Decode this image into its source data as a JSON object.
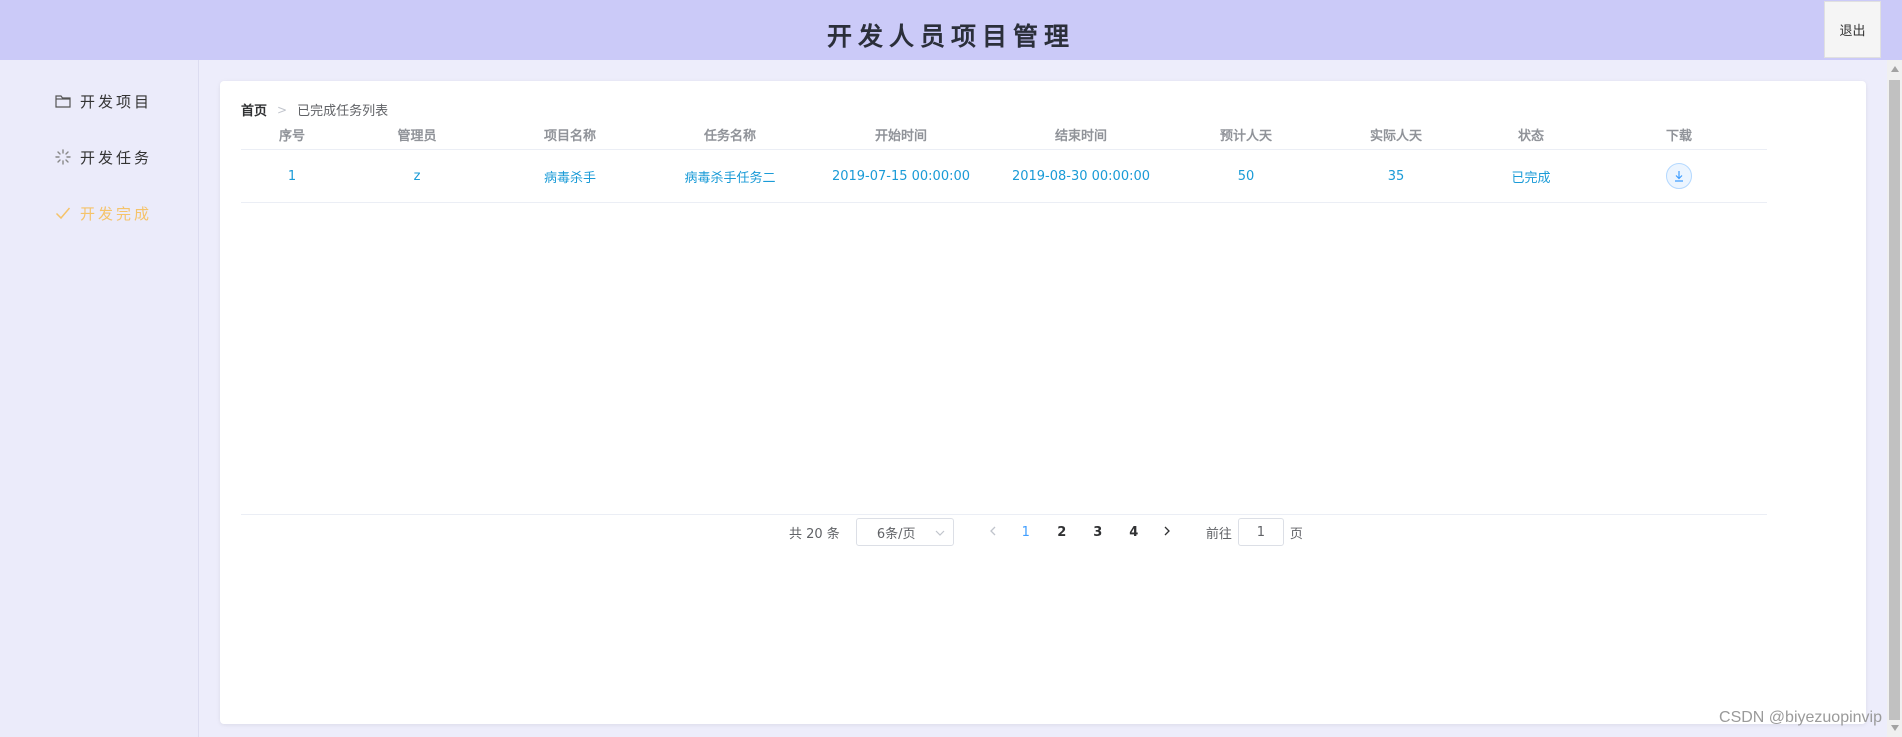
{
  "header": {
    "title": "开发人员项目管理",
    "logout_label": "退出"
  },
  "sidebar": {
    "items": [
      {
        "label": "开发项目",
        "icon": "folder-icon"
      },
      {
        "label": "开发任务",
        "icon": "loading-icon"
      },
      {
        "label": "开发完成",
        "icon": "check-icon",
        "active": true
      }
    ]
  },
  "breadcrumb": {
    "home": "首页",
    "current": "已完成任务列表"
  },
  "table": {
    "columns": [
      "序号",
      "管理员",
      "项目名称",
      "任务名称",
      "开始时间",
      "结束时间",
      "预计人天",
      "实际人天",
      "状态",
      "下载"
    ],
    "rows": [
      [
        "1",
        "z",
        "病毒杀手",
        "病毒杀手任务二",
        "2019-07-15 00:00:00",
        "2019-08-30 00:00:00",
        "50",
        "35",
        "已完成"
      ]
    ]
  },
  "pagination": {
    "total_text": "共 20 条",
    "page_size": "6条/页",
    "pages": [
      "1",
      "2",
      "3",
      "4"
    ],
    "current_page": "1",
    "goto_prefix": "前往",
    "goto_value": "1",
    "goto_suffix": "页"
  },
  "watermark": "CSDN @biyezuopinvip",
  "colors": {
    "header_bg": "#cbcaf8",
    "sidebar_bg": "#ebebfa",
    "active_nav": "#f5c36a",
    "link": "#1a9bd7"
  }
}
